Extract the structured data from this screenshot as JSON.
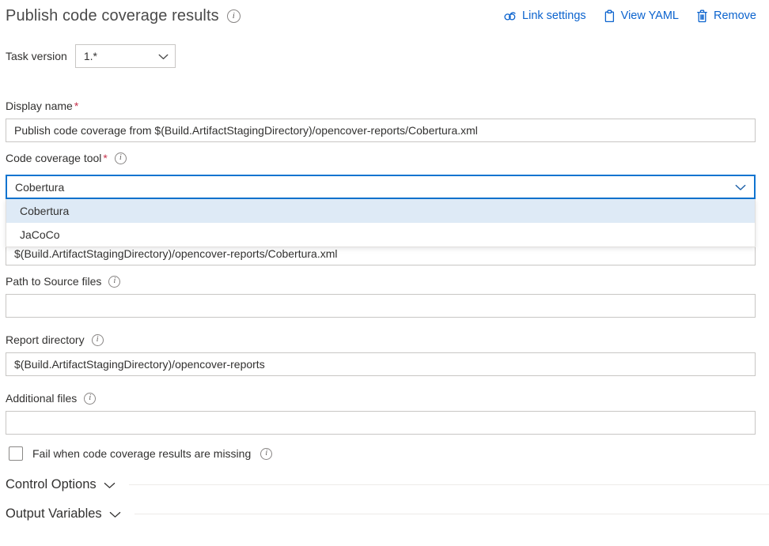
{
  "header": {
    "title": "Publish code coverage results",
    "info_icon": "info-icon",
    "actions": [
      {
        "label": "Link settings",
        "icon": "link-icon"
      },
      {
        "label": "View YAML",
        "icon": "clipboard-icon"
      },
      {
        "label": "Remove",
        "icon": "trash-icon"
      }
    ]
  },
  "task_version": {
    "label": "Task version",
    "value": "1.*",
    "chevron": "chevron-down-icon"
  },
  "fields": {
    "display_name": {
      "label": "Display name",
      "required": "*",
      "value": "Publish code coverage from $(Build.ArtifactStagingDirectory)/opencover-reports/Cobertura.xml",
      "placeholder": ""
    },
    "code_coverage_tool": {
      "label": "Code coverage tool",
      "required": "*",
      "value": "Cobertura",
      "options": [
        "Cobertura",
        "JaCoCo"
      ],
      "selected_option": "Cobertura"
    },
    "summary_file": {
      "value": "$(Build.ArtifactStagingDirectory)/opencover-reports/Cobertura.xml"
    },
    "path_to_source_files": {
      "label": "Path to Source files",
      "value": "",
      "placeholder": ""
    },
    "report_directory": {
      "label": "Report directory",
      "value": "$(Build.ArtifactStagingDirectory)/opencover-reports",
      "placeholder": ""
    },
    "additional_files": {
      "label": "Additional files",
      "value": "",
      "placeholder": ""
    },
    "fail_when_missing": {
      "label": "Fail when code coverage results are missing",
      "checked": false
    }
  },
  "sections": [
    {
      "title": "Control Options",
      "chevron": "chevron-down-icon"
    },
    {
      "title": "Output Variables",
      "chevron": "chevron-down-icon"
    }
  ],
  "colors": {
    "accent": "#0078d4",
    "link": "#0b63ce",
    "focus_border": "#0f74d0",
    "option_highlight": "#deeaf6",
    "required_star": "#c4314b",
    "border": "#c8c6c4"
  }
}
